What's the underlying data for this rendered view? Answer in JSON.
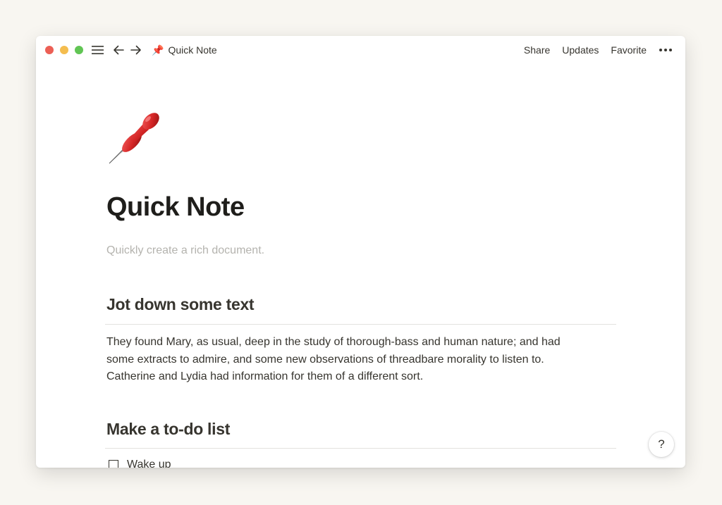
{
  "titlebar": {
    "breadcrumb_icon": "📌",
    "breadcrumb_title": "Quick Note",
    "actions": {
      "share": "Share",
      "updates": "Updates",
      "favorite": "Favorite"
    },
    "icons": [
      "menu-icon",
      "back-arrow-icon",
      "forward-arrow-icon",
      "more-icon"
    ]
  },
  "page": {
    "icon": "pushpin-icon",
    "title": "Quick Note",
    "description": "Quickly create a rich document.",
    "sections": {
      "jot": {
        "heading": "Jot down some text",
        "lines": [
          "They found Mary, as usual, deep in the study of thorough-bass and human nature; and had",
          "some extracts to admire, and some new observations of threadbare morality to listen to.",
          "Catherine and Lydia had information for them of a different sort."
        ]
      },
      "todo": {
        "heading": "Make a to-do list",
        "items": [
          {
            "label": "Wake up",
            "checked": false
          }
        ]
      }
    }
  },
  "help": {
    "label": "?"
  },
  "colors": {
    "background": "#f8f6f1",
    "text": "#37352f",
    "muted": "#b4b3ae",
    "close": "#ec5f55",
    "minimize": "#f4bd4f",
    "zoom": "#61c554"
  }
}
